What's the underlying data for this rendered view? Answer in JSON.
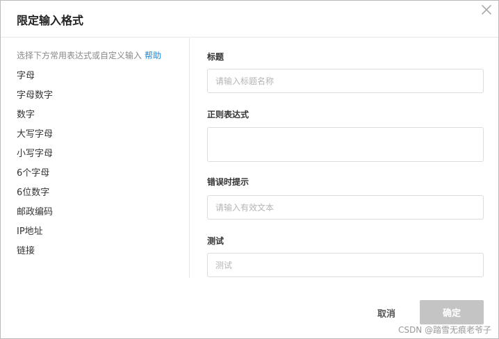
{
  "dialog": {
    "title": "限定输入格式"
  },
  "left_panel": {
    "hint": "选择下方常用表达式或自定义输入",
    "help_link": "帮助",
    "presets": [
      "字母",
      "字母数字",
      "数字",
      "大写字母",
      "小写字母",
      "6个字母",
      "6位数字",
      "邮政编码",
      "IP地址",
      "链接"
    ]
  },
  "form": {
    "title_label": "标题",
    "title_placeholder": "请输入标题名称",
    "title_value": "",
    "regex_label": "正则表达式",
    "regex_value": "",
    "error_label": "错误时提示",
    "error_placeholder": "请输入有效文本",
    "error_value": "",
    "test_label": "测试",
    "test_placeholder": "测试",
    "test_value": ""
  },
  "footer": {
    "cancel_label": "取消",
    "ok_label": "确定"
  },
  "watermark": "CSDN @踏雪无痕老爷子",
  "colors": {
    "help_link": "#1e88d8",
    "ok_button_disabled": "#c4c4c4",
    "border": "#dcdcdc"
  },
  "icons": {
    "close": "close-icon"
  }
}
